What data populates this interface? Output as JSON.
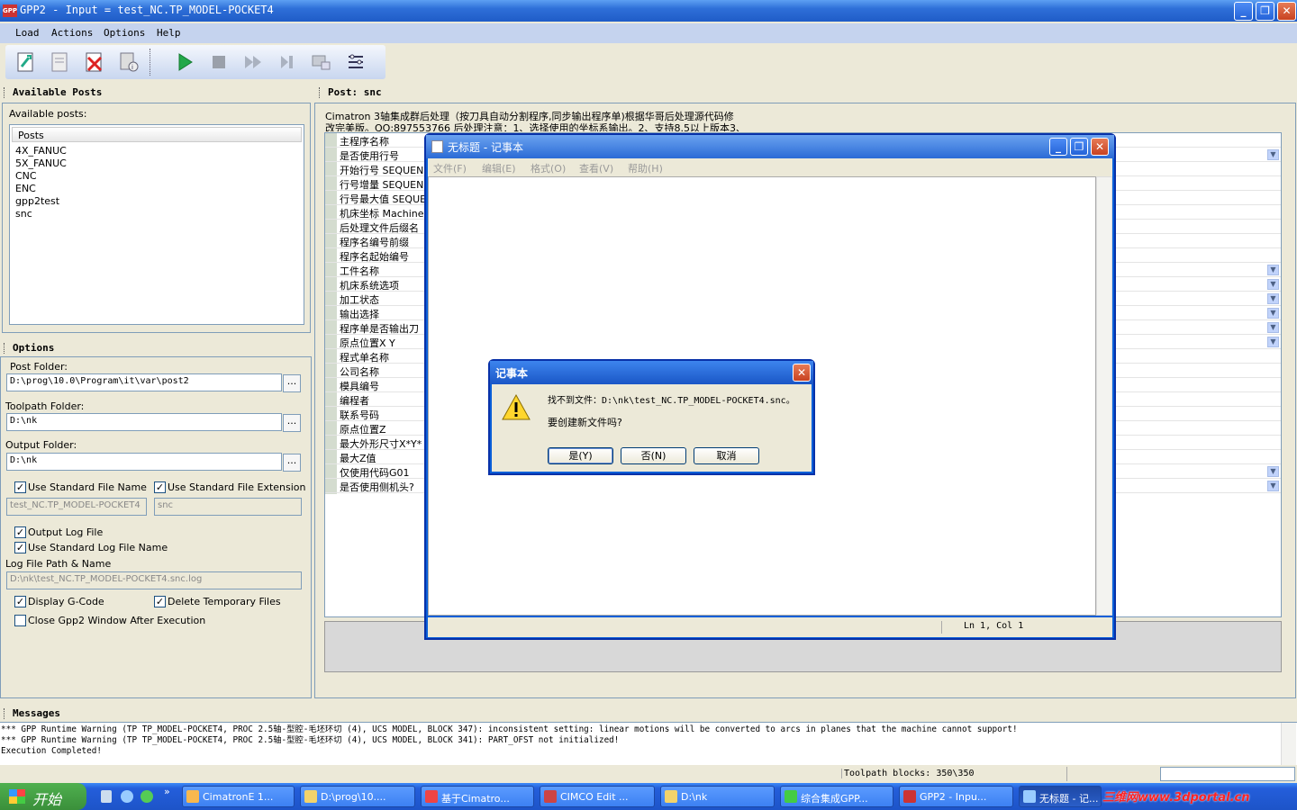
{
  "window": {
    "title": "GPP2 - Input = test_NC.TP_MODEL-POCKET4",
    "app_icon_text": "GPP"
  },
  "menu": [
    "Load",
    "Actions",
    "Options",
    "Help"
  ],
  "posts_panel": {
    "header": "Available Posts",
    "label": "Available posts:",
    "column": "Posts",
    "items": [
      "4X_FANUC",
      "5X_FANUC",
      "CNC",
      "ENC",
      "gpp2test",
      "snc"
    ]
  },
  "options_panel": {
    "header": "Options",
    "post_folder_label": "Post Folder:",
    "post_folder": "D:\\prog\\10.0\\Program\\it\\var\\post2",
    "toolpath_folder_label": "Toolpath Folder:",
    "toolpath_folder": "D:\\nk",
    "output_folder_label": "Output Folder:",
    "output_folder": "D:\\nk",
    "browse": "...",
    "use_std_file_name": "Use Standard File Name",
    "use_std_file_ext": "Use Standard File Extension",
    "std_file_name_value": "test_NC.TP_MODEL-POCKET4",
    "std_file_ext_value": "snc",
    "output_log": "Output Log File",
    "use_std_log": "Use Standard Log File Name",
    "log_path_label": "Log File Path & Name",
    "log_path": "D:\\nk\\test_NC.TP_MODEL-POCKET4.snc.log",
    "display_gcode": "Display G-Code",
    "delete_temp": "Delete Temporary Files",
    "close_after": "Close Gpp2 Window After Execution"
  },
  "post_panel": {
    "header": "Post: snc",
    "desc1": "Cimatron 3轴集成群后处理（按刀具自动分割程序,同步输出程序单)根据华哥后处理源代码修",
    "desc2": "改完美版。QQ:897553766 后处理注意：1、选择使用的坐标系输出。2、支持8.5以上版本3、",
    "params": [
      "主程序名称",
      "是否使用行号",
      "开始行号 SEQUENCE",
      "行号增量 SEQUENCE",
      "行号最大值 SEQUENCE",
      "机床坐标 Machine",
      "后处理文件后缀名",
      "程序名编号前缀",
      "程序名起始编号",
      "工件名称",
      "机床系统选项",
      "加工状态",
      "输出选择",
      "程序单是否输出刀",
      "原点位置X Y",
      "程式单名称",
      "公司名称",
      "模具编号",
      "编程者",
      "联系号码",
      "原点位置Z",
      "最大外形尺寸X*Y*",
      "最大Z值",
      "仅使用代码G01",
      "是否使用侧机头?"
    ]
  },
  "notepad": {
    "title": "无标题 - 记事本",
    "menu": [
      "文件(F)",
      "编辑(E)",
      "格式(O)",
      "查看(V)",
      "帮助(H)"
    ],
    "status": "Ln 1, Col 1"
  },
  "dialog": {
    "title": "记事本",
    "line1": "找不到文件：D:\\nk\\test_NC.TP_MODEL-POCKET4.snc。",
    "line2": "要创建新文件吗?",
    "yes": "是(Y)",
    "no": "否(N)",
    "cancel": "取消"
  },
  "messages": {
    "header": "Messages",
    "lines": [
      "*** GPP Runtime Warning (TP TP_MODEL-POCKET4, PROC 2.5轴-型腔-毛坯环切 (4), UCS MODEL, BLOCK 347): inconsistent setting: linear motions will be converted to arcs in planes that the machine cannot support!",
      "*** GPP Runtime Warning (TP TP_MODEL-POCKET4, PROC 2.5轴-型腔-毛坯环切 (4), UCS MODEL, BLOCK 341): PART_OFST not initialized!",
      "Execution Completed!"
    ]
  },
  "status": {
    "blocks": "Toolpath blocks: 350\\350"
  },
  "taskbar": {
    "start": "开始",
    "tasks": [
      "CimatronE 1...",
      "D:\\prog\\10....",
      "基于Cimatro...",
      "CIMCO Edit ...",
      "D:\\nk",
      "综合集成GPP...",
      "GPP2 - Inpu...",
      "无标题 - 记..."
    ],
    "watermark": "三维网www.3dportal.cn"
  }
}
